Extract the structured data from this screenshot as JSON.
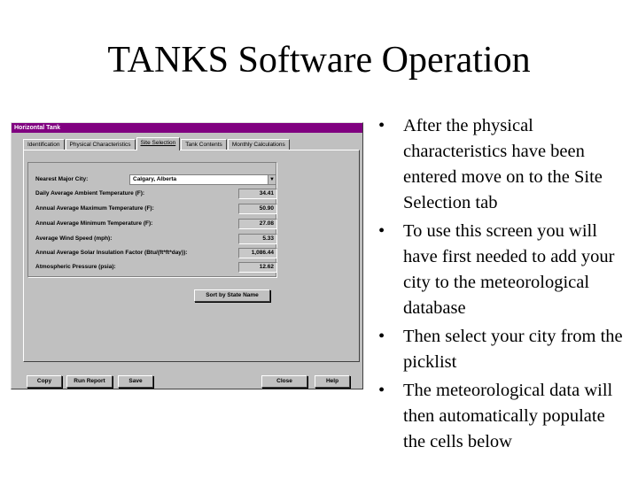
{
  "slide": {
    "title": "TANKS Software Operation",
    "bullets": [
      "After the physical characteristics have been entered move on to the Site Selection tab",
      "To use this screen you will have first needed to add your city to the meteorological database",
      "Then select your city from the picklist",
      "The meteorological data will then automatically populate the cells below"
    ]
  },
  "window": {
    "title": "Horizontal Tank",
    "tabs": [
      "Identification",
      "Physical Characteristics",
      "Site Selection",
      "Tank Contents",
      "Monthly Calculations"
    ],
    "active_tab": "Site Selection",
    "colors": {
      "titlebar": "#800080",
      "face": "#c0c0c0"
    }
  },
  "form": {
    "city_label": "Nearest Major City:",
    "city_value": "Calgary, Alberta",
    "fields": [
      {
        "label": "Daily Average Ambient Temperature (F):",
        "value": "34.41"
      },
      {
        "label": "Annual Average Maximum Temperature (F):",
        "value": "50.90"
      },
      {
        "label": "Annual Average Minimum Temperature (F):",
        "value": "27.08"
      },
      {
        "label": "Average Wind Speed (mph):",
        "value": "5.33"
      },
      {
        "label": "Annual Average Solar Insulation Factor (Btu/(ft*ft*day)):",
        "value": "1,086.44"
      },
      {
        "label": "Atmospheric Pressure (psia):",
        "value": "12.62"
      }
    ],
    "sort_button": "Sort by State Name"
  },
  "buttons": {
    "copy": "Copy",
    "run_report": "Run Report",
    "save": "Save",
    "close": "Close",
    "help": "Help"
  }
}
